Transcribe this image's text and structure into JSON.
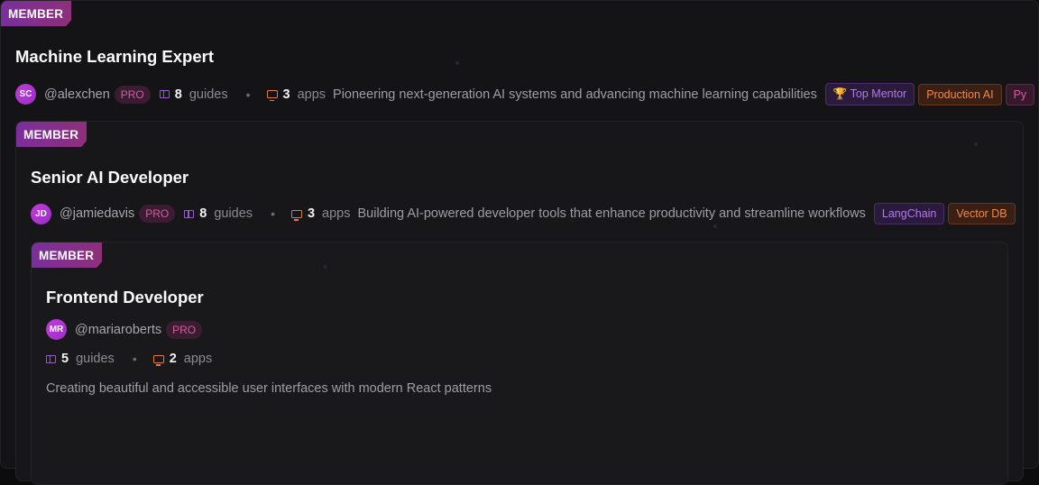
{
  "cards": [
    {
      "badge": "MEMBER",
      "title": "Machine Learning Expert",
      "avatar_initials": "SC",
      "handle": "@alexchen",
      "pro_label": "PRO",
      "guides_count": "8",
      "guides_label": "guides",
      "apps_count": "3",
      "apps_label": "apps",
      "description": "Pioneering next-generation AI systems and advancing machine learning capabilities",
      "tags": [
        {
          "label": "🏆 Top Mentor",
          "color": "purple"
        },
        {
          "label": "Production AI",
          "color": "orange"
        },
        {
          "label": "Py",
          "color": "pink"
        }
      ]
    },
    {
      "badge": "MEMBER",
      "title": "Senior AI Developer",
      "avatar_initials": "JD",
      "handle": "@jamiedavis",
      "pro_label": "PRO",
      "guides_count": "8",
      "guides_label": "guides",
      "apps_count": "3",
      "apps_label": "apps",
      "description": "Building AI-powered developer tools that enhance productivity and streamline workflows",
      "tags": [
        {
          "label": "LangChain",
          "color": "purple"
        },
        {
          "label": "Vector DB",
          "color": "orange"
        }
      ]
    },
    {
      "badge": "MEMBER",
      "title": "Frontend Developer",
      "avatar_initials": "MR",
      "handle": "@mariaroberts",
      "pro_label": "PRO",
      "guides_count": "5",
      "guides_label": "guides",
      "apps_count": "2",
      "apps_label": "apps",
      "description": "Creating beautiful and accessible user interfaces with modern React patterns"
    }
  ],
  "colors": {
    "badge_gradient": [
      "#7a2f9c",
      "#8e2f7a"
    ],
    "guides_icon": "#9c56d8",
    "apps_icon": "#e27b3c",
    "pro_text": "#d35d9e"
  },
  "icons": {
    "guides": "book-icon",
    "apps": "monitor-icon"
  }
}
